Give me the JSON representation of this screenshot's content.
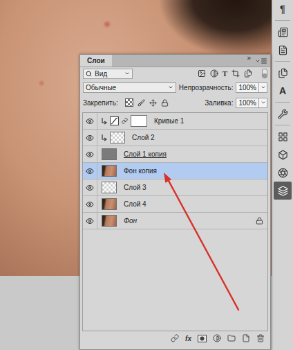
{
  "toolbar": [
    {
      "kind": "glyph",
      "glyph": "¶",
      "selected": false
    },
    {
      "kind": "icon",
      "selected": false
    },
    {
      "kind": "icon",
      "selected": false
    },
    {
      "kind": "icon",
      "selected": false
    },
    {
      "kind": "glyph",
      "glyph": "A",
      "selected": false
    },
    {
      "kind": "icon",
      "selected": false
    },
    {
      "kind": "icon",
      "selected": false
    },
    {
      "kind": "icon",
      "selected": false
    },
    {
      "kind": "icon",
      "selected": false
    },
    {
      "kind": "icon",
      "selected": true
    }
  ],
  "panel": {
    "title": "Слои",
    "collapse": "»",
    "filter": {
      "value": "Вид",
      "type_glyph": "T",
      "toggle_on": false
    },
    "blend": {
      "value": "Обычные",
      "opacity_label": "Непрозрачность:",
      "opacity": "100%"
    },
    "lock": {
      "label": "Закрепить:",
      "fill_label": "Заливка:",
      "fill": "100%"
    },
    "layers": [
      {
        "name": "Кривые 1",
        "visible": true,
        "selected": false,
        "kind": "adjustment",
        "clipped": true,
        "underlined": false,
        "background": false
      },
      {
        "name": "Слой 2",
        "visible": true,
        "selected": false,
        "kind": "transparent",
        "clipped": true,
        "underlined": false,
        "background": false
      },
      {
        "name": "Слой 1 копия",
        "visible": true,
        "selected": false,
        "kind": "gray",
        "clipped": false,
        "underlined": true,
        "background": false
      },
      {
        "name": "Фон копия",
        "visible": true,
        "selected": true,
        "kind": "photo",
        "clipped": false,
        "underlined": false,
        "background": false
      },
      {
        "name": "Слой 3",
        "visible": true,
        "selected": false,
        "kind": "transparent",
        "clipped": false,
        "underlined": false,
        "background": false
      },
      {
        "name": "Слой 4",
        "visible": true,
        "selected": false,
        "kind": "photo",
        "clipped": false,
        "underlined": false,
        "background": false
      },
      {
        "name": "Фон",
        "visible": true,
        "selected": false,
        "kind": "photo",
        "clipped": false,
        "underlined": false,
        "background": true
      }
    ],
    "footer": {
      "fx": "fx"
    }
  }
}
